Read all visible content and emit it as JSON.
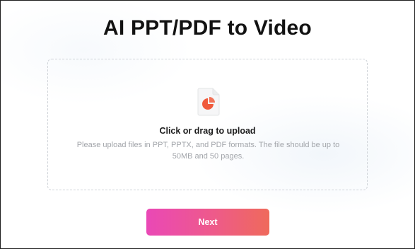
{
  "page": {
    "title": "AI PPT/PDF to Video"
  },
  "upload": {
    "icon": "pdf-file-pie-icon",
    "prompt": "Click or drag to upload",
    "description": "Please upload files in PPT, PPTX, and PDF formats. The file should be up to 50MB and 50 pages."
  },
  "actions": {
    "next_label": "Next"
  },
  "colors": {
    "title_text": "#121212",
    "dropzone_border": "#cfd3d8",
    "description_text": "#a2a5aa",
    "icon_accent": "#f05a3c",
    "button_gradient_start": "#ea48b6",
    "button_gradient_end": "#ef6a5b"
  }
}
